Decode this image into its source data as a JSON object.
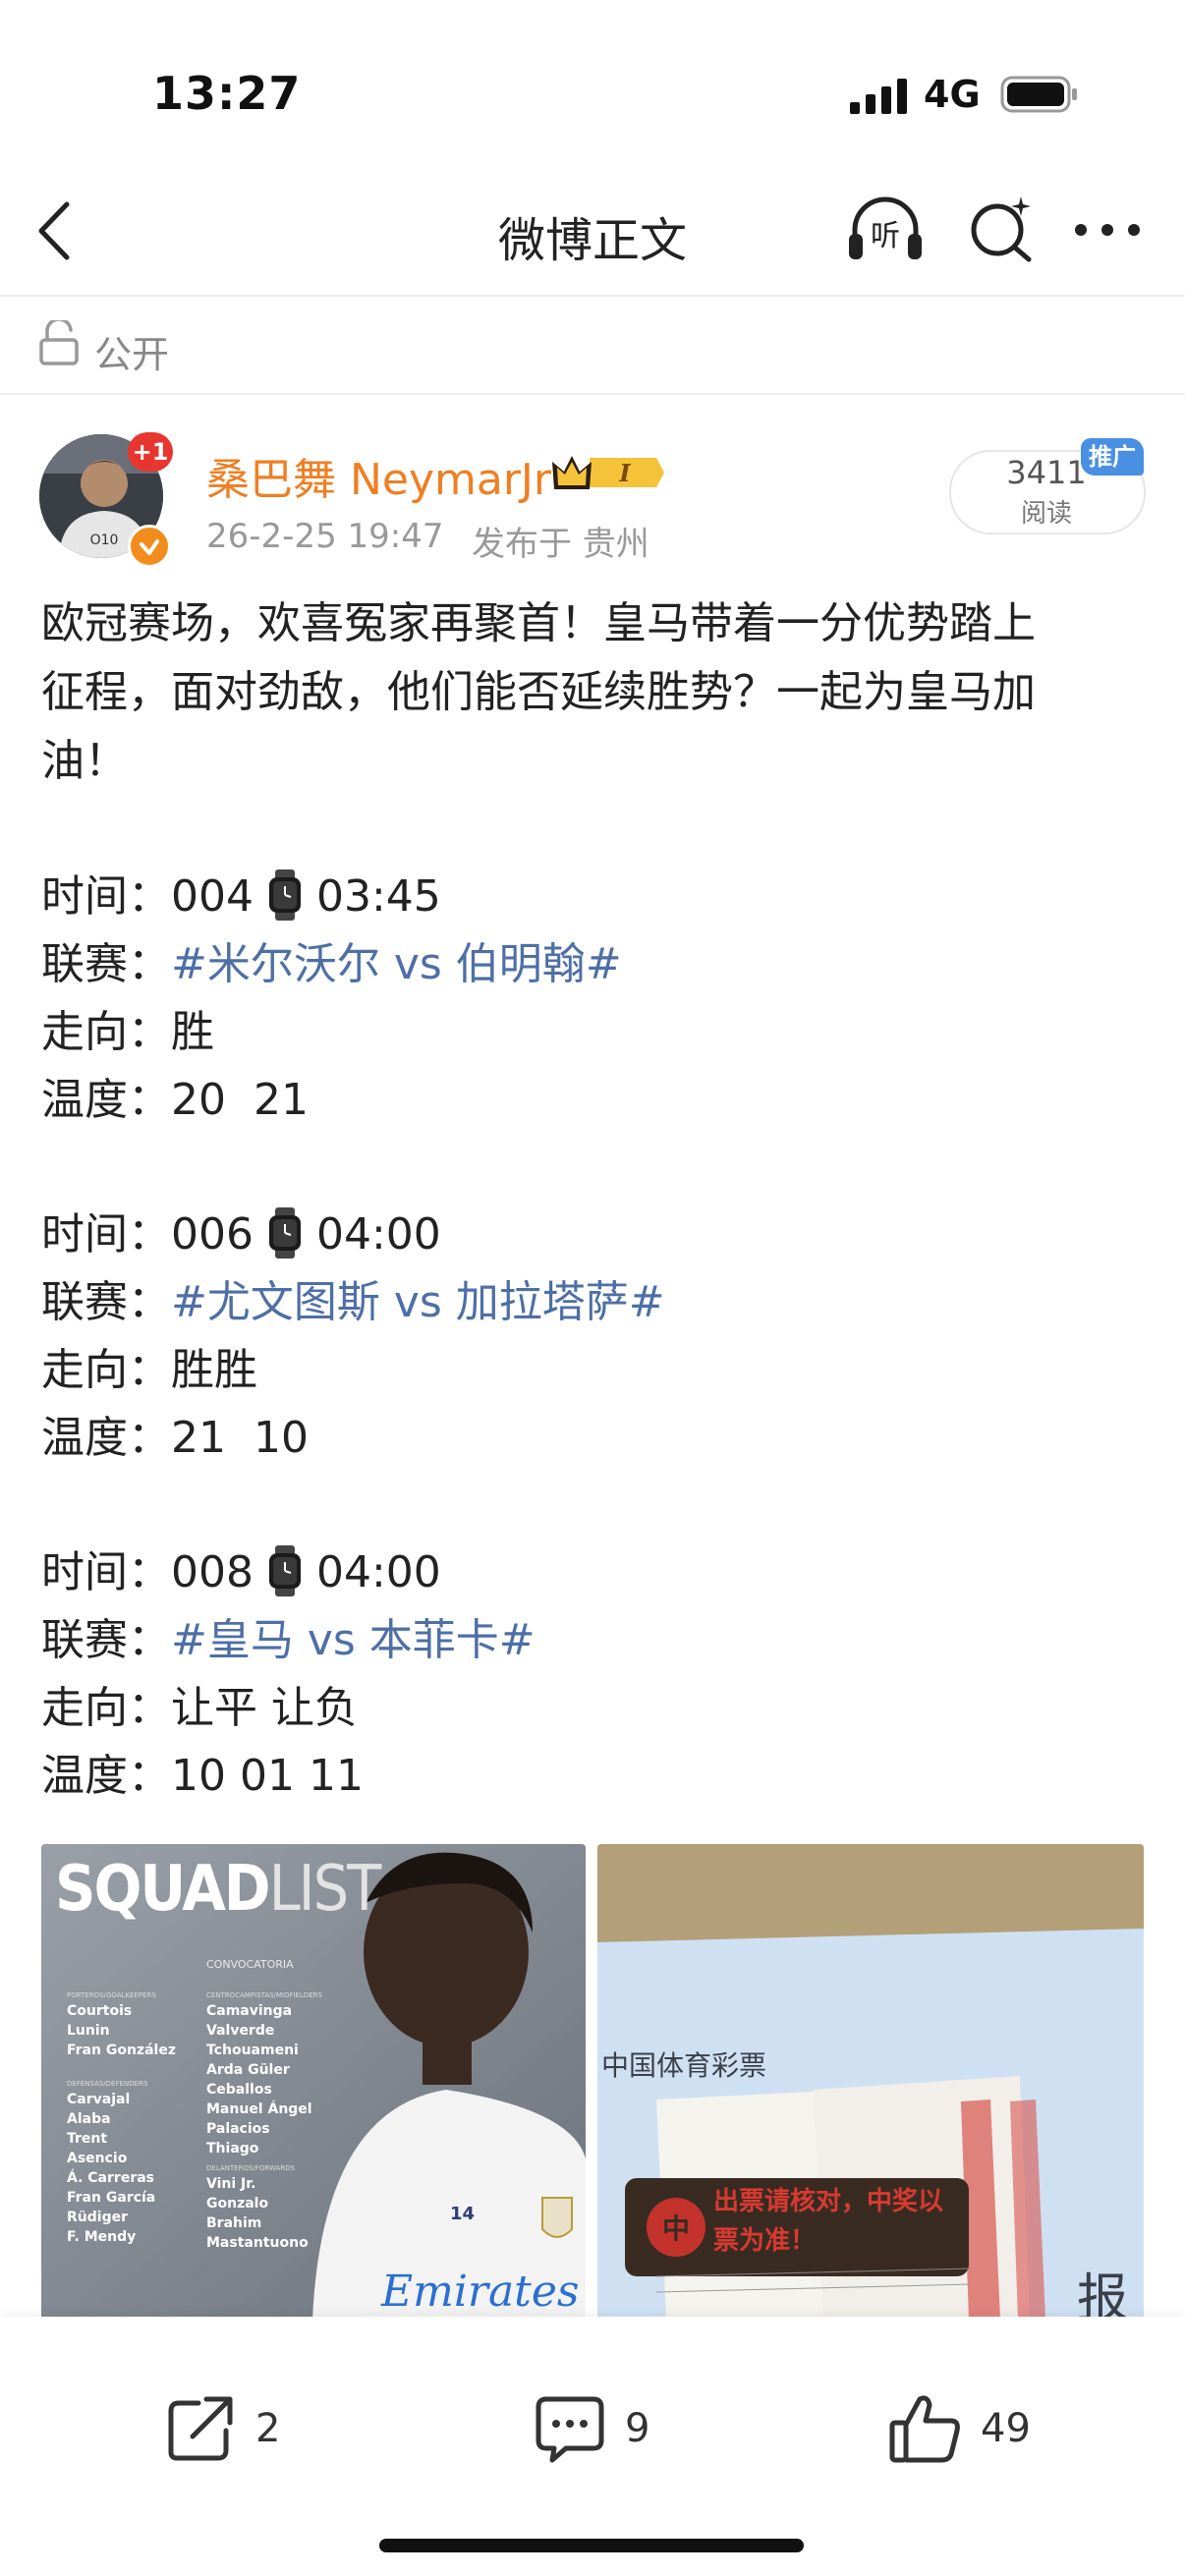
{
  "status_bar": {
    "time": "13:27",
    "network": "4G"
  },
  "nav": {
    "title": "微博正文"
  },
  "visibility": "公开",
  "author": {
    "name": "桑巴舞 NeymarJr",
    "badge_plus": "+1",
    "date": "26-2-25 19:47",
    "location": "发布于 贵州",
    "verified_color": "#f28c1c"
  },
  "reads": {
    "count": "3411",
    "label": "阅读",
    "ad_tag": "推广"
  },
  "post": {
    "intro_lines": [
      "欧冠赛场，欢喜冤家再聚首！皇马带着一分优势踏上",
      "征程，面对劲敌，他们能否延续胜势？一起为皇马加",
      "油！"
    ],
    "matches": [
      {
        "time_label": "时间：",
        "code": "004",
        "kickoff": "03:45",
        "league_label": "联赛：",
        "topic": "#米尔沃尔 vs 伯明翰#",
        "dir_label": "走向：",
        "direction": "胜",
        "temp_label": "温度：",
        "temp": "20  21"
      },
      {
        "time_label": "时间：",
        "code": "006",
        "kickoff": "04:00",
        "league_label": "联赛：",
        "topic": "#尤文图斯 vs 加拉塔萨#",
        "dir_label": "走向：",
        "direction": "胜胜",
        "temp_label": "温度：",
        "temp": "21  10"
      },
      {
        "time_label": "时间：",
        "code": "008",
        "kickoff": "04:00",
        "league_label": "联赛：",
        "topic": "#皇马 vs 本菲卡#",
        "dir_label": "走向：",
        "direction": "让平 让负",
        "temp_label": "温度：",
        "temp": "10 01 11"
      }
    ]
  },
  "image1": {
    "title_main": "SQUAD",
    "title_sub": "LIST",
    "subtitle": "CONVOCATORIA",
    "gk_header": "PORTEROS/GOALKEEPERS",
    "goalkeepers": [
      "Courtois",
      "Lunin",
      "Fran González"
    ],
    "def_header": "DEFENSAS/DEFENDERS",
    "defenders": [
      "Carvajal",
      "Alaba",
      "Trent",
      "Asencio",
      "Á. Carreras",
      "Fran García",
      "Rüdiger",
      "F. Mendy"
    ],
    "mid_header": "CENTROCAMPISTAS/MIDFIELDERS",
    "midfielders": [
      "Camavinga",
      "Valverde",
      "Tchouameni",
      "Arda Güler",
      "Ceballos",
      "Manuel Ángel",
      "Palacios",
      "Thiago"
    ],
    "fwd_header": "DELANTEROS/FORWARDS",
    "forwards": [
      "Vini Jr.",
      "Gonzalo",
      "Brahim",
      "Mastantuono"
    ],
    "shirt_number": "14",
    "sponsor": "Emirates"
  },
  "image2": {
    "lottery_name": "中国体育彩票",
    "stamp_text": "出票请核对，中奖以票为准！",
    "side_text": "报告"
  },
  "toolbar": {
    "share_count": "2",
    "comment_count": "9",
    "like_count": "49"
  }
}
